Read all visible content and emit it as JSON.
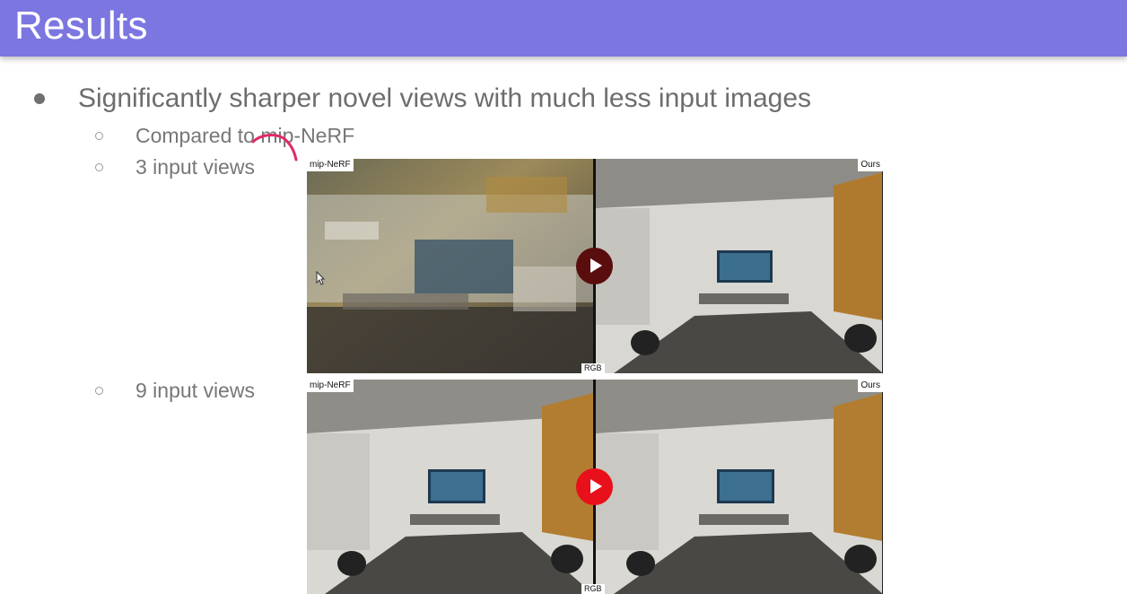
{
  "slide": {
    "title": "Results",
    "bullet": "Significantly sharper novel views with much less input images",
    "sub_items": [
      "Compared to mip-NeRF",
      "3 input views",
      "9 input views"
    ]
  },
  "videos": [
    {
      "left_label": "mip-NeRF",
      "right_label": "Ours",
      "bottom_label": "RGB",
      "play_color": "#5a0d0d"
    },
    {
      "left_label": "mip-NeRF",
      "right_label": "Ours",
      "bottom_label": "RGB",
      "play_color": "#e8101a"
    }
  ],
  "colors": {
    "title_bar": "#7b76e0",
    "annotation": "#e02a6a"
  }
}
